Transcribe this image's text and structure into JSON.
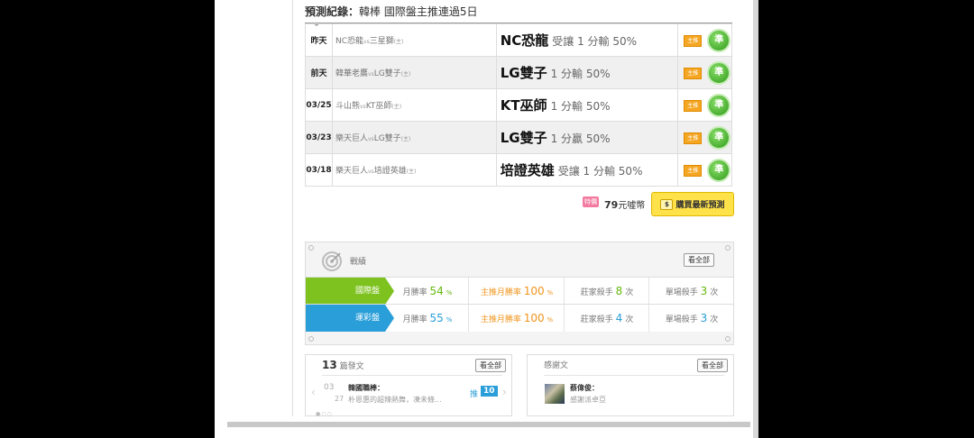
{
  "header": {
    "label": "預測紀錄：",
    "text": "韓棒 國際盤主推連過5日"
  },
  "predictions": [
    {
      "date": "昨天",
      "home": "NC恐龍",
      "away": "三星獅",
      "host": "(主)",
      "team": "NC恐龍",
      "line": "受讓 1 分輸 50%",
      "tag": "主推",
      "badge": "準"
    },
    {
      "date": "前天",
      "home": "韓華老鷹",
      "away": "LG雙子",
      "host": "(主)",
      "team": "LG雙子",
      "line": "1 分輸 50%",
      "tag": "主推",
      "badge": "準"
    },
    {
      "date": "03/25",
      "home": "斗山熊",
      "away": "KT巫師",
      "host": "(主)",
      "team": "KT巫師",
      "line": "1 分輸 50%",
      "tag": "主推",
      "badge": "準"
    },
    {
      "date": "03/23",
      "home": "樂天巨人",
      "away": "LG雙子",
      "host": "(主)",
      "team": "LG雙子",
      "line": "1 分贏 50%",
      "tag": "主推",
      "badge": "準"
    },
    {
      "date": "03/18",
      "home": "樂天巨人",
      "away": "培證英雄",
      "host": "(主)",
      "team": "培證英雄",
      "line": "受讓 1 分輸 50%",
      "tag": "主推",
      "badge": "準"
    }
  ],
  "vs": "vs",
  "purchase": {
    "badge": "特價",
    "price": "79",
    "unit": "元噓幣",
    "button": "購買最新預測"
  },
  "record": {
    "label": "戰績",
    "view_all": "看全部",
    "rows": [
      {
        "name": "國際盤",
        "color": "#7dc21e",
        "month_label": "月勝率",
        "month_val": "54",
        "main_label": "主推月勝率",
        "main_val": "100",
        "pct": "%",
        "banker_label": "莊家殺手",
        "banker_val": "8",
        "single_label": "單場殺手",
        "single_val": "3",
        "times": "次"
      },
      {
        "name": "運彩盤",
        "color": "#2a9ed8",
        "month_label": "月勝率",
        "month_val": "55",
        "main_label": "主推月勝率",
        "main_val": "100",
        "pct": "%",
        "banker_label": "莊家殺手",
        "banker_val": "4",
        "single_label": "單場殺手",
        "single_val": "3",
        "times": "次"
      }
    ]
  },
  "posts": {
    "count": "13",
    "label": "篇發文",
    "view_all": "看全部",
    "item": {
      "month": "03",
      "day": "27",
      "title": "韓國職棒：",
      "excerpt": "朴恩惠的超辣熱舞，凍未條...",
      "tui": "推",
      "tui_count": "10"
    }
  },
  "thanks": {
    "label": "感謝文",
    "view_all": "看全部",
    "item": {
      "name": "蔡偉俊：",
      "text": "感謝派卓亞"
    }
  }
}
